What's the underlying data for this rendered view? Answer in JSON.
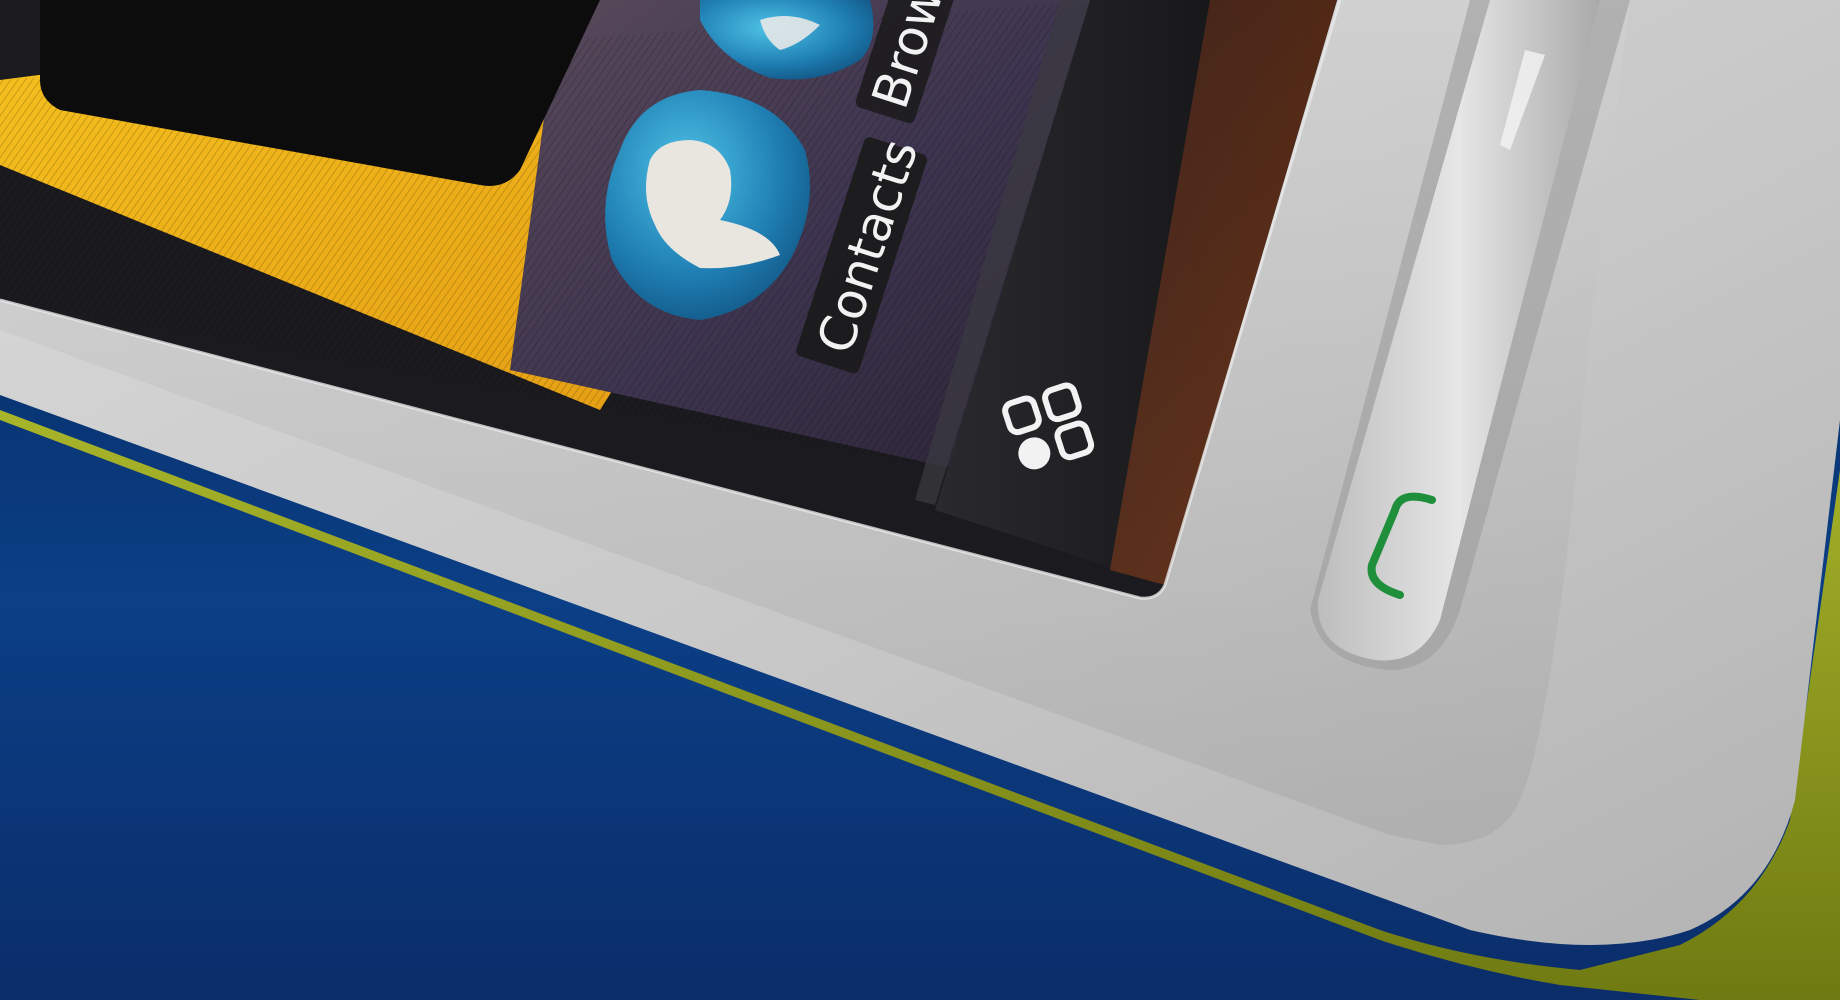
{
  "scene": {
    "background_color": "#0a2c66",
    "device_body_color": "#c9c9c9",
    "device_trim_color": "#8c9a1a",
    "screen": {
      "wallpaper_colors": [
        "#f2b21b",
        "#6a4a3c",
        "#3b3049"
      ],
      "apps": [
        {
          "label": "Contacts",
          "icon": "contacts-person-icon",
          "interactable": true
        },
        {
          "label": "Brow",
          "icon": "browser-globe-icon",
          "interactable": true
        }
      ],
      "menu_icon": "applications-menu-icon"
    },
    "call_key": {
      "icon": "phone-call-icon",
      "icon_color": "#1f8f3c"
    }
  }
}
